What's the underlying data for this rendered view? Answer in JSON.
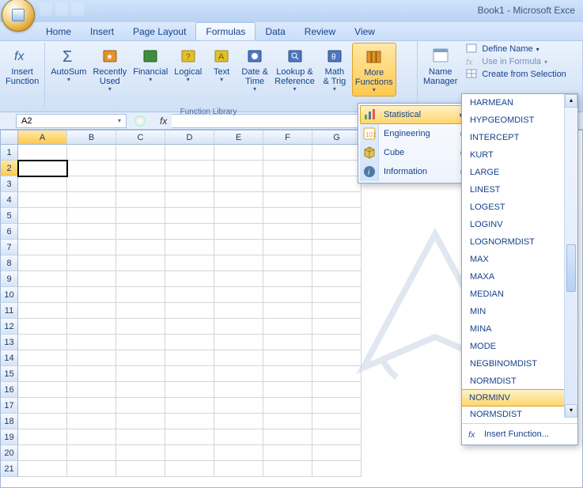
{
  "title": "Book1 - Microsoft Exce",
  "tabs": [
    "Home",
    "Insert",
    "Page Layout",
    "Formulas",
    "Data",
    "Review",
    "View"
  ],
  "active_tab": "Formulas",
  "ribbon": {
    "insert_fn": "Insert\nFunction",
    "autosum": "AutoSum",
    "recently": "Recently\nUsed",
    "financial": "Financial",
    "logical": "Logical",
    "text": "Text",
    "datetime": "Date &\nTime",
    "lookup": "Lookup &\nReference",
    "math": "Math\n& Trig",
    "more": "More\nFunctions",
    "group_label": "Function Library",
    "name_mgr": "Name\nManager",
    "define_name": "Define Name",
    "use_in_formula": "Use in Formula",
    "create_sel": "Create from Selection"
  },
  "namebox": "A2",
  "fx_label": "fx",
  "columns": [
    "A",
    "B",
    "C",
    "D",
    "E",
    "F",
    "G"
  ],
  "rows": [
    "1",
    "2",
    "3",
    "4",
    "5",
    "6",
    "7",
    "8",
    "9",
    "10",
    "11",
    "12",
    "13",
    "14",
    "15",
    "16",
    "17",
    "18",
    "19",
    "20",
    "21"
  ],
  "active_cell": {
    "col": 0,
    "row": 1
  },
  "menu1": {
    "statistical": "Statistical",
    "engineering": "Engineering",
    "cube": "Cube",
    "information": "Information"
  },
  "stat_items": [
    "HARMEAN",
    "HYPGEOMDIST",
    "INTERCEPT",
    "KURT",
    "LARGE",
    "LINEST",
    "LOGEST",
    "LOGINV",
    "LOGNORMDIST",
    "MAX",
    "MAXA",
    "MEDIAN",
    "MIN",
    "MINA",
    "MODE",
    "NEGBINOMDIST",
    "NORMDIST",
    "NORMINV",
    "NORMSDIST"
  ],
  "stat_selected": "NORMINV",
  "insert_function": "Insert Function..."
}
